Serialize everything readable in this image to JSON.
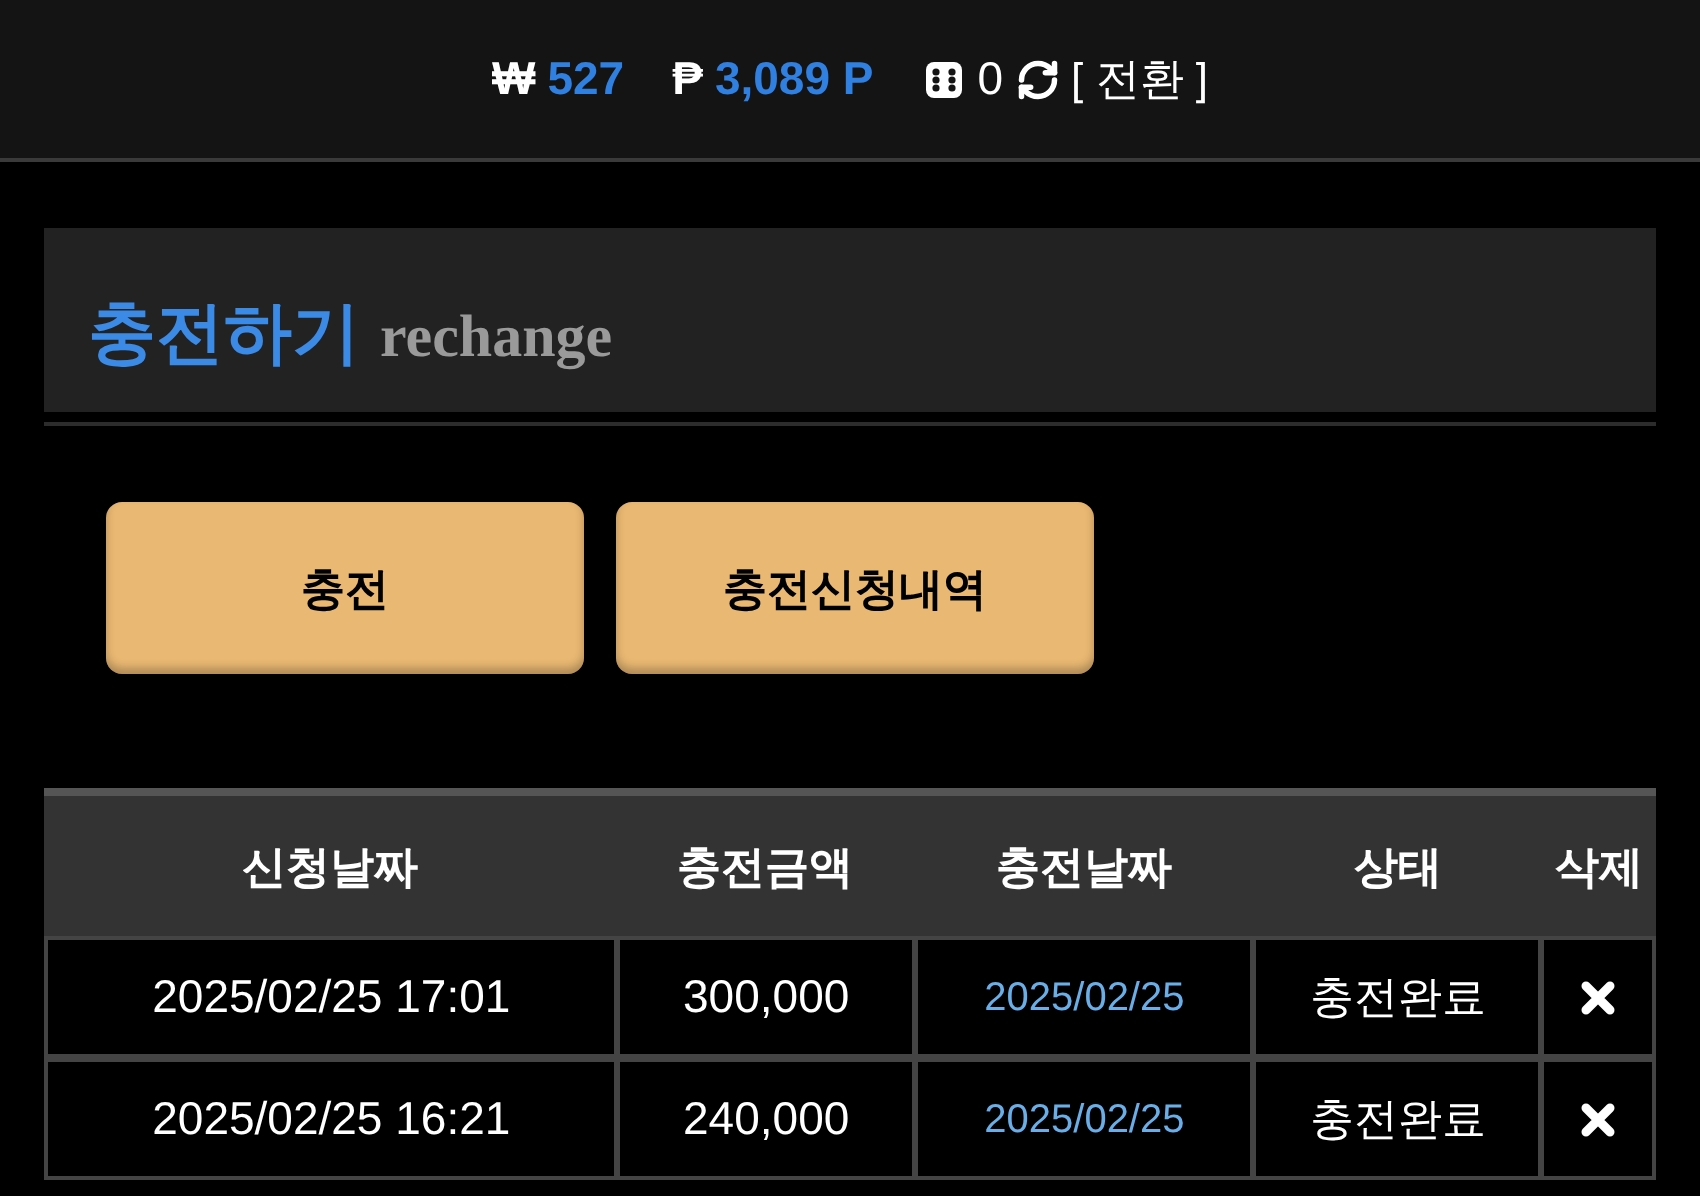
{
  "top_bar": {
    "won_symbol": "₩",
    "won_amount": "527",
    "point_symbol": "₱",
    "point_amount": "3,089 P",
    "dice_count": "0",
    "switch_link": "[ 전환 ]"
  },
  "panel": {
    "title": "충전하기",
    "subtitle": "rechange"
  },
  "buttons": [
    "충전",
    "충전신청내역"
  ],
  "table": {
    "columns": [
      "신청날짜",
      "충전금액",
      "충전날짜",
      "상태",
      "삭제"
    ],
    "rows": [
      {
        "requested": "2025/02/25 17:01",
        "amount": "300,000",
        "charged": "2025/02/25",
        "status": "충전완료"
      },
      {
        "requested": "2025/02/25 16:21",
        "amount": "240,000",
        "charged": "2025/02/25",
        "status": "충전완료"
      }
    ]
  }
}
